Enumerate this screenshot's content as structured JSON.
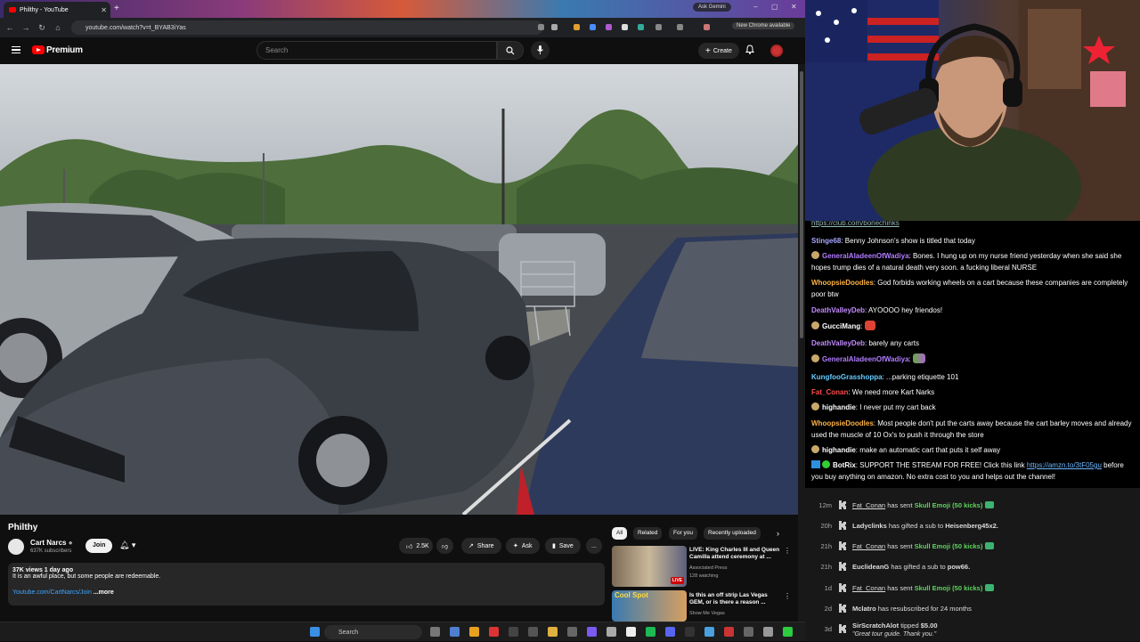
{
  "browser": {
    "tab_title": "Philthy - YouTube",
    "new_tab": "+",
    "ask_gemini": "Ask Gemini",
    "url": "youtube.com/watch?v=t_BYAB3iYas",
    "chrome_badge": "New Chrome available",
    "window_controls": [
      "–",
      "▢",
      "✕"
    ]
  },
  "youtube": {
    "logo_text": "Premium",
    "search_placeholder": "Search",
    "create_label": "Create",
    "video": {
      "title": "Philthy",
      "channel": "Cart Narcs",
      "subscribers": "637K subscribers",
      "join_label": "Join",
      "likes": "2.5K",
      "share_label": "Share",
      "ask_label": "Ask",
      "save_label": "Save",
      "more_label": "...",
      "views_date": "37K views  1 day ago",
      "description": "It is an awful place, but some people are redeemable.",
      "desc_link": "Youtube.com/CartNarcs/Join",
      "desc_more": "...more"
    },
    "related_chips": [
      "All",
      "Related",
      "For you",
      "Recently uploaded"
    ],
    "related": [
      {
        "title": "LIVE: King Charles III and Queen Camilla attend ceremony at ...",
        "channel": "Associated Press",
        "meta": "128 watching",
        "badge": "LIVE"
      },
      {
        "title": "Is this an off strip Las Vegas GEM, or is there a reason ...",
        "channel": "Show Me Vegas",
        "thumb_text": "Cool Spot"
      }
    ]
  },
  "taskbar": {
    "search_placeholder": "Search"
  },
  "chat": {
    "top_link": "https://club.com/bonechinks",
    "messages": [
      {
        "user": "Stinge68",
        "color": "#a7a7ff",
        "text": "Benny Johnson's show is titled that today"
      },
      {
        "user": "GeneralAladeenOfWadiya",
        "color": "#b27cff",
        "text": "Bones. I hung up on my nurse friend yesterday when she said she hopes trump dies of a natural death very soon. a fucking liberal NURSE",
        "badge": true
      },
      {
        "user": "WhoopsieDoodles",
        "color": "#ffb347",
        "text": "God forbids working wheels on a cart because these companies are completely poor btw"
      },
      {
        "user": "DeathValleyDeb",
        "color": "#c38cff",
        "text": "AYOOOO hey friendos!"
      },
      {
        "user": "GucciMang",
        "color": "#ffffff",
        "text": "",
        "badge": true
      },
      {
        "user": "DeathValleyDeb",
        "color": "#c38cff",
        "text": "barely any carts"
      },
      {
        "user": "GeneralAladeenOfWadiya",
        "color": "#b27cff",
        "text": "",
        "badge": true
      },
      {
        "user": "KungfooGrasshoppa",
        "color": "#66ccff",
        "text": "...parking etiquette 101"
      },
      {
        "user": "Fat_Conan",
        "color": "#ff4d4d",
        "text": "We need more Kart Narks"
      },
      {
        "user": "highandie",
        "color": "#ffffff",
        "text": "I never put my cart back",
        "badge": true
      },
      {
        "user": "WhoopsieDoodles",
        "color": "#ffb347",
        "text": "Most people don't put the carts away because the cart barley moves and already used the muscle of 10 Ox's to push it through the store"
      },
      {
        "user": "highandie",
        "color": "#ffffff",
        "text": "make an automatic cart that puts it self away",
        "badge": true
      },
      {
        "user": "BotRix",
        "color": "#ffffff",
        "text": "SUPPORT THE STREAM FOR FREE! Click this link",
        "link": "https://amzn.to/3tF05gu",
        "text2": "before you buy anything on amazon. No extra cost to you and helps out the channel!"
      }
    ]
  },
  "events": [
    {
      "time": "12m",
      "user": "Fat_Conan",
      "action": "has sent",
      "item": "Skull Emoji (50 kicks)"
    },
    {
      "time": "20h",
      "user": "Ladyclinks",
      "action": "has gifted a sub to",
      "target": "Heisenberg45x2."
    },
    {
      "time": "21h",
      "user": "Fat_Conan",
      "action": "has sent",
      "item": "Skull Emoji (50 kicks)"
    },
    {
      "time": "21h",
      "user": "EuclideanG",
      "action": "has gifted a sub to",
      "target": "pow66."
    },
    {
      "time": "1d",
      "user": "Fat_Conan",
      "action": "has sent",
      "item": "Skull Emoji (50 kicks)"
    },
    {
      "time": "2d",
      "user": "Mclatro",
      "action": "has resubscribed for 24 months"
    },
    {
      "time": "3d",
      "user": "SirScratchAlot",
      "action": "tipped",
      "amount": "$5.00",
      "note": "\"Great tour guide. Thank you.\""
    }
  ]
}
